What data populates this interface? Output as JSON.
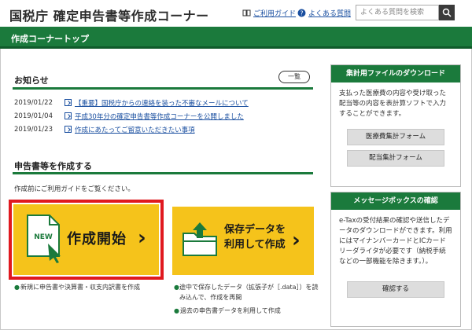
{
  "header": {
    "title": "国税庁 確定申告書等作成コーナー",
    "guide_link": "ご利用ガイド",
    "faq_link": "よくある質問",
    "search_placeholder": "よくある質問を検索"
  },
  "topbar": {
    "label": "作成コーナートップ"
  },
  "notices": {
    "title": "お知らせ",
    "more_button": "一覧",
    "items": [
      {
        "date": "2019/01/22",
        "text": "【重要】国税庁からの連絡を装った不審なメールについて"
      },
      {
        "date": "2019/01/04",
        "text": "平成30年分の確定申告書等作成コーナーを公開しました"
      },
      {
        "date": "2019/01/23",
        "text": "作成にあたってご留意いただきたい事項"
      }
    ]
  },
  "create": {
    "title": "申告書等を作成する",
    "guide_text": "作成前にご利用ガイドをご覧ください。",
    "start_tile": {
      "badge": "NEW",
      "label": "作成開始",
      "chevron": "›"
    },
    "saved_tile": {
      "label_line1": "保存データを",
      "label_line2": "利用して作成",
      "chevron": "›"
    },
    "start_bullets": [
      "新規に申告書や決算書・収支内訳書を作成"
    ],
    "saved_bullets": [
      "途中で保存したデータ（拡張子が［.data］）を読み込んで、作成を再開",
      "過去の申告書データを利用して作成"
    ]
  },
  "sidebar": {
    "tally": {
      "title": "集計用ファイルのダウンロード",
      "text": "支払った医療費の内容や受け取った配当等の内容を表計算ソフトで入力することができます。",
      "buttons": [
        "医療費集計フォーム",
        "配当集計フォーム"
      ]
    },
    "message": {
      "title": "メッセージボックスの確認",
      "text": "e-Taxの受付結果の確認や送信したデータのダウンロードができます。利用にはマイナンバーカードとICカードリーダライタが必要です（納税手続などの一部機能を除きます。）。",
      "button": "確認する"
    }
  },
  "colors": {
    "brand_green": "#1b7a3c",
    "tile_yellow": "#f5c31b",
    "highlight_red": "#e0191f",
    "link_blue": "#1a4fa0"
  }
}
